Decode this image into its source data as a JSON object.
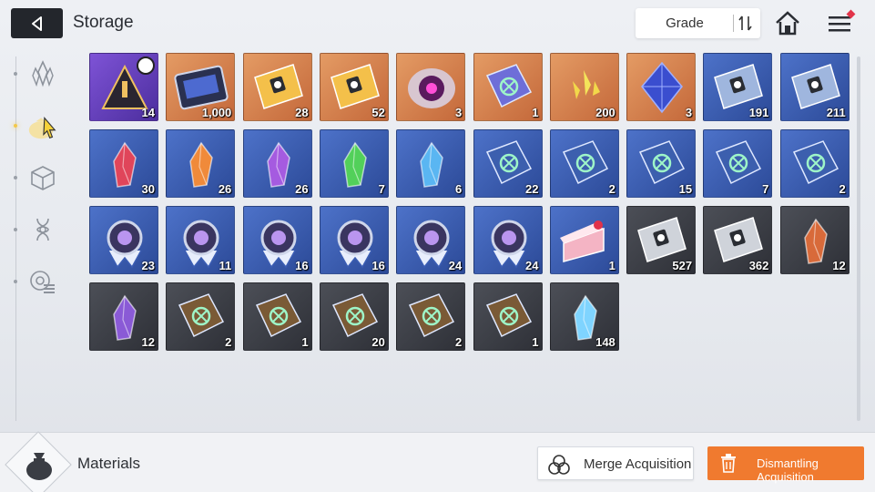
{
  "header": {
    "title": "Storage",
    "grade_label": "Grade"
  },
  "sidebar": {
    "tabs": [
      {
        "icon": "crystal-cluster-icon",
        "active": false
      },
      {
        "icon": "material-bag-icon",
        "active": true
      },
      {
        "icon": "cube-icon",
        "active": false
      },
      {
        "icon": "dna-icon",
        "active": false
      },
      {
        "icon": "chip-icon",
        "active": false
      }
    ]
  },
  "inventory": {
    "rows": [
      [
        {
          "name": "Time-limited triangle token",
          "grade": "purple",
          "qty": "14",
          "icon": "triangle-token-icon",
          "timer": true
        },
        {
          "name": "Chip tablet",
          "grade": "orange",
          "qty": "1,000",
          "icon": "chip-tablet-icon"
        },
        {
          "name": "Gold ticket portrait",
          "grade": "orange",
          "qty": "28",
          "icon": "gold-ticket-portrait-icon"
        },
        {
          "name": "Gold ticket star",
          "grade": "orange",
          "qty": "52",
          "icon": "gold-ticket-star-icon"
        },
        {
          "name": "Eye orb",
          "grade": "orange",
          "qty": "3",
          "icon": "eye-orb-icon"
        },
        {
          "name": "Rainbow book",
          "grade": "orange",
          "qty": "1",
          "icon": "rainbow-book-icon"
        },
        {
          "name": "Golden shards",
          "grade": "orange",
          "qty": "200",
          "icon": "golden-shards-icon"
        },
        {
          "name": "Blue octahedron",
          "grade": "orange",
          "qty": "3",
          "icon": "blue-octahedron-icon"
        },
        {
          "name": "Blue ticket portrait",
          "grade": "blue",
          "qty": "191",
          "icon": "blue-ticket-portrait-icon"
        },
        {
          "name": "Blue ticket star",
          "grade": "blue",
          "qty": "211",
          "icon": "blue-ticket-star-icon"
        }
      ],
      [
        {
          "name": "Red crystal",
          "grade": "blue",
          "qty": "30",
          "icon": "red-crystal-icon"
        },
        {
          "name": "Orange crystal",
          "grade": "blue",
          "qty": "26",
          "icon": "orange-crystal-icon"
        },
        {
          "name": "Purple crystal",
          "grade": "blue",
          "qty": "26",
          "icon": "purple-crystal-icon"
        },
        {
          "name": "Green crystal",
          "grade": "blue",
          "qty": "7",
          "icon": "green-crystal-icon"
        },
        {
          "name": "Blue crystal",
          "grade": "blue",
          "qty": "6",
          "icon": "blue-crystal-icon"
        },
        {
          "name": "Book swords",
          "grade": "blue",
          "qty": "22",
          "icon": "book-swords-icon"
        },
        {
          "name": "Book shield",
          "grade": "blue",
          "qty": "2",
          "icon": "book-shield-icon"
        },
        {
          "name": "Book wings",
          "grade": "blue",
          "qty": "15",
          "icon": "book-wings-icon"
        },
        {
          "name": "Book target",
          "grade": "blue",
          "qty": "7",
          "icon": "book-target-icon"
        },
        {
          "name": "Book orbit",
          "grade": "blue",
          "qty": "2",
          "icon": "book-orbit-icon"
        }
      ],
      [
        {
          "name": "Medal cross",
          "grade": "blue",
          "qty": "23",
          "icon": "medal-cross-icon"
        },
        {
          "name": "Medal shield",
          "grade": "blue",
          "qty": "11",
          "icon": "medal-shield-icon"
        },
        {
          "name": "Medal square",
          "grade": "blue",
          "qty": "16",
          "icon": "medal-square-icon"
        },
        {
          "name": "Medal bolt",
          "grade": "blue",
          "qty": "16",
          "icon": "medal-bolt-icon"
        },
        {
          "name": "Medal spark",
          "grade": "blue",
          "qty": "24",
          "icon": "medal-spark-icon"
        },
        {
          "name": "Medal ring",
          "grade": "blue",
          "qty": "24",
          "icon": "medal-ring-icon"
        },
        {
          "name": "Cake slice",
          "grade": "blue",
          "qty": "1",
          "icon": "cake-slice-icon"
        },
        {
          "name": "Silver ticket portrait",
          "grade": "dark",
          "qty": "527",
          "icon": "silver-ticket-portrait-icon"
        },
        {
          "name": "Silver ticket star",
          "grade": "dark",
          "qty": "362",
          "icon": "silver-ticket-star-icon"
        },
        {
          "name": "Amber crystal",
          "grade": "dark",
          "qty": "12",
          "icon": "amber-crystal-icon"
        }
      ],
      [
        {
          "name": "Dark violet crystal",
          "grade": "dark",
          "qty": "12",
          "icon": "violet-crystal-icon"
        },
        {
          "name": "Bronze book swords",
          "grade": "dark",
          "qty": "2",
          "icon": "bronze-book-swords-icon"
        },
        {
          "name": "Bronze book shield",
          "grade": "dark",
          "qty": "1",
          "icon": "bronze-book-shield-icon"
        },
        {
          "name": "Bronze book wings",
          "grade": "dark",
          "qty": "20",
          "icon": "bronze-book-wings-icon"
        },
        {
          "name": "Bronze book target",
          "grade": "dark",
          "qty": "2",
          "icon": "bronze-book-target-icon"
        },
        {
          "name": "Bronze book orbit",
          "grade": "dark",
          "qty": "1",
          "icon": "bronze-book-orbit-icon"
        },
        {
          "name": "Ice crystal cluster",
          "grade": "dark",
          "qty": "148",
          "icon": "ice-crystal-icon"
        }
      ]
    ]
  },
  "footer": {
    "category_label": "Materials",
    "merge_label": "Merge Acquisition",
    "dismantle_label": "Dismantling Acquisition"
  },
  "colors": {
    "accent_orange": "#f07a2f",
    "grade_purple": "#6a44c0",
    "grade_orange": "#d9844f",
    "grade_blue": "#3b5db3",
    "grade_dark": "#3a3d44"
  }
}
